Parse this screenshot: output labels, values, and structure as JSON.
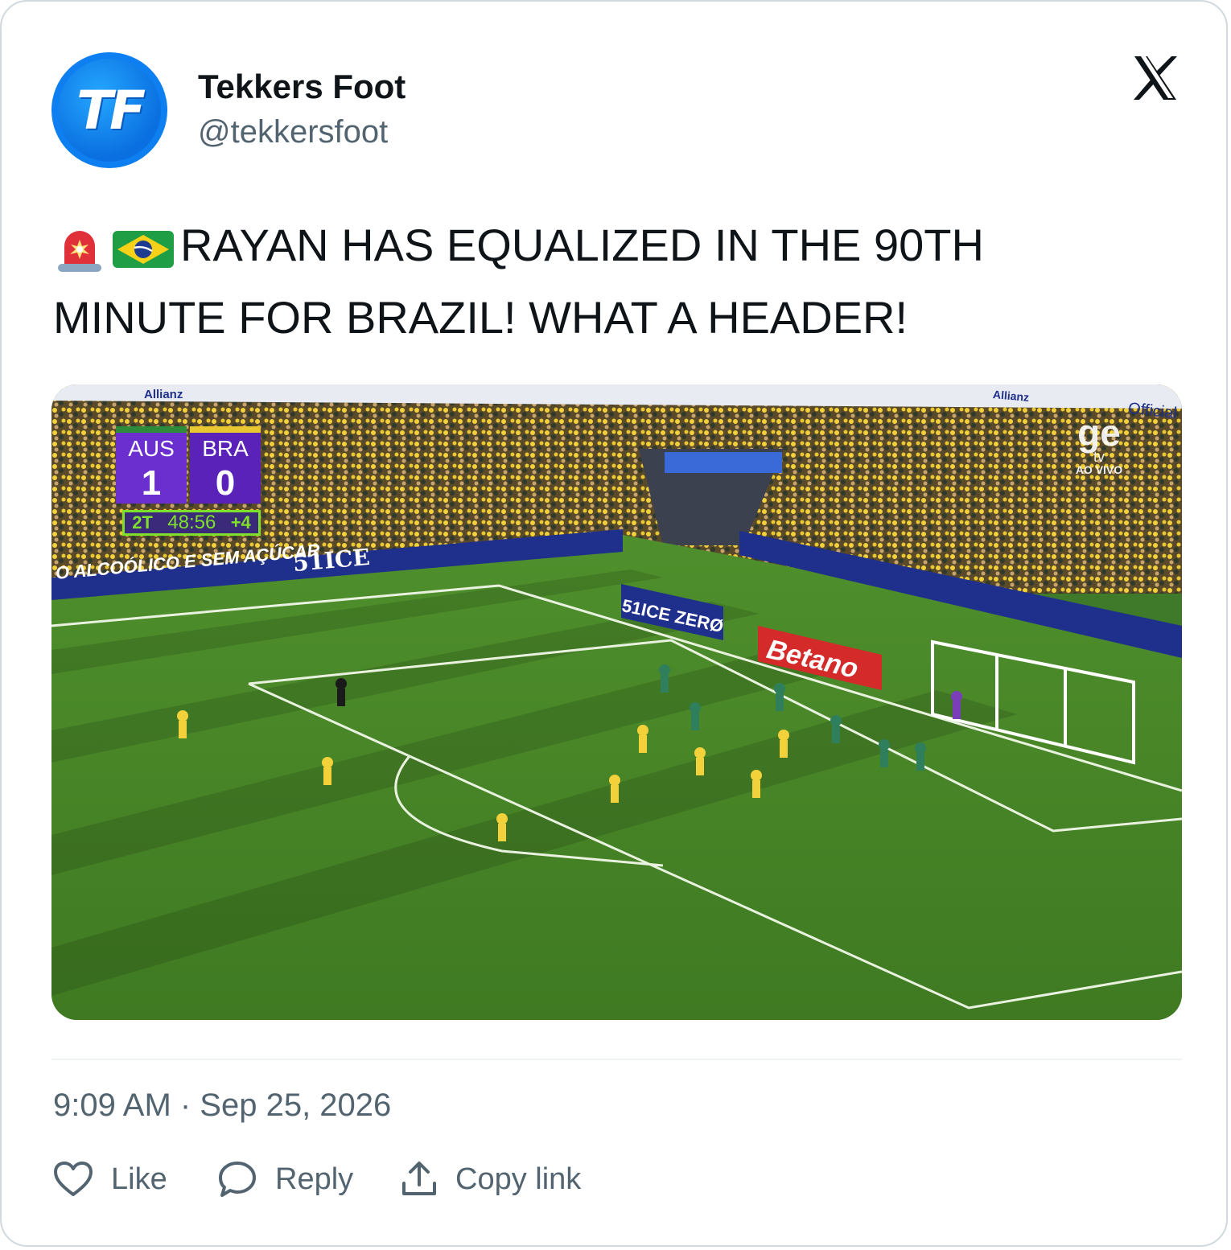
{
  "author": {
    "name": "Tekkers Foot",
    "handle": "@tekkersfoot",
    "avatar_text": "TF"
  },
  "tweet": {
    "line1": "RAYAN HAS EQUALIZED IN THE 90TH",
    "line2": "MINUTE FOR BRAZIL! WHAT A HEADER!",
    "emojis": [
      "police-car-light-emoji",
      "brazil-flag-emoji"
    ]
  },
  "media": {
    "scoreboard": {
      "home": "AUS",
      "away": "BRA",
      "home_score": "1",
      "away_score": "0",
      "period": "2T",
      "clock": "48:56",
      "added": "+4"
    },
    "broadcaster": {
      "logo": "ge",
      "sub": "tv",
      "live": "AO VIVO"
    },
    "ads": {
      "left_board": "O ALCOÓLICO E SEM AÇÚCAR",
      "brand": "51ICE",
      "zero_board": "51ICE ZERØ",
      "betano": "Betano",
      "allianz": "Allianz",
      "official": "Official"
    }
  },
  "timestamp": "9:09 AM · Sep 25, 2026",
  "actions": {
    "like": "Like",
    "reply": "Reply",
    "copy": "Copy link"
  },
  "colors": {
    "text": "#0f1419",
    "muted": "#536471",
    "border": "#cfd9de",
    "pitch": "#4c8a2e",
    "scoreboard": "#5a22b8",
    "clock_green": "#7ee02a"
  }
}
